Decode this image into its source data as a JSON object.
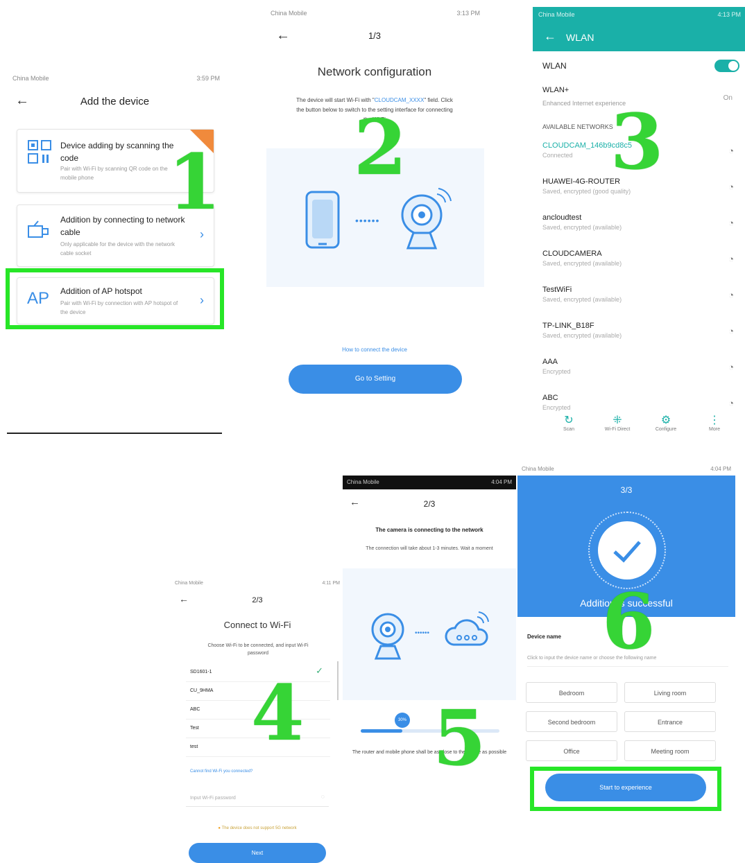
{
  "s1": {
    "status_left": "China Mobile",
    "status_right": "3:59 PM",
    "title": "Add the device",
    "opt1_title": "Device adding by scanning the code",
    "opt1_sub": "Pair with Wi-Fi by scanning QR code on the mobile phone",
    "opt2_title": "Addition by connecting to network cable",
    "opt2_sub": "Only applicable for the device with the network cable socket",
    "opt3_icon": "AP",
    "opt3_title": "Addition of AP hotspot",
    "opt3_sub": "Pair with Wi-Fi by connection with AP hotspot of the device",
    "step": "1"
  },
  "s2": {
    "status_left": "China Mobile",
    "status_right": "3:13 PM",
    "step_counter": "1/3",
    "title": "Network configuration",
    "desc_pre": "The device will start Wi-Fi with \"",
    "desc_link": "CLOUDCAM_XXXX",
    "desc_post": "\" field. Click the button below to switch to the setting interface for connecting the Wi-Fi",
    "help_link": "How to connect the device",
    "button": "Go to Setting",
    "step": "2"
  },
  "s3": {
    "status_left": "China Mobile",
    "status_right": "4:13 PM",
    "header": "WLAN",
    "wlan_label": "WLAN",
    "wlanplus_label": "WLAN+",
    "wlanplus_sub": "Enhanced Internet experience",
    "wlanplus_value": "On",
    "section": "AVAILABLE NETWORKS",
    "networks": [
      {
        "name": "CLOUDCAM_146b9cd8c5",
        "status": "Connected"
      },
      {
        "name": "HUAWEI-4G-ROUTER",
        "status": "Saved, encrypted (good quality)"
      },
      {
        "name": "ancloudtest",
        "status": "Saved, encrypted (available)"
      },
      {
        "name": "CLOUDCAMERA",
        "status": "Saved, encrypted (available)"
      },
      {
        "name": "TestWiFi",
        "status": "Saved, encrypted (available)"
      },
      {
        "name": "TP-LINK_B18F",
        "status": "Saved, encrypted (available)"
      },
      {
        "name": "AAA",
        "status": "Encrypted"
      },
      {
        "name": "ABC",
        "status": "Encrypted"
      }
    ],
    "bottom": [
      "Scan",
      "Wi-Fi Direct",
      "Configure",
      "More"
    ],
    "step": "3"
  },
  "s4": {
    "status_left": "China Mobile",
    "status_right": "4:11 PM",
    "step_counter": "2/3",
    "title": "Connect to Wi-Fi",
    "desc": "Choose Wi-Fi to be connected, and input Wi-Fi password",
    "networks": [
      "SD1601-1",
      "CU_9HMA",
      "ABC",
      "Test",
      "test"
    ],
    "link": "Cannot find Wi-Fi you connected?",
    "password_placeholder": "Input Wi-Fi password",
    "warning": "The device does not support 5G network",
    "button": "Next",
    "step": "4"
  },
  "s5": {
    "status_left": "China Mobile",
    "status_right": "4:04 PM",
    "step_counter": "2/3",
    "title": "The camera is connecting to the network",
    "desc": "The connection will take about 1-3 minutes. Wait a moment",
    "progress_label": "30%",
    "progress": 0.3,
    "note": "The router and mobile phone shall be as close to the device as possible",
    "step": "5"
  },
  "s6": {
    "status_left": "China Mobile",
    "status_right": "4:04 PM",
    "step_counter": "3/3",
    "success": "Addition is successful",
    "name_label": "Device name",
    "name_hint": "Click to input the device name or choose the following name",
    "names": [
      "Bedroom",
      "Living room",
      "Second bedroom",
      "Entrance",
      "Office",
      "Meeting room"
    ],
    "button": "Start to experience",
    "step": "6"
  },
  "colors": {
    "accent": "#3a8ee6",
    "teal": "#1ab0a8",
    "highlight": "#27e627",
    "step_number": "#36d436"
  }
}
